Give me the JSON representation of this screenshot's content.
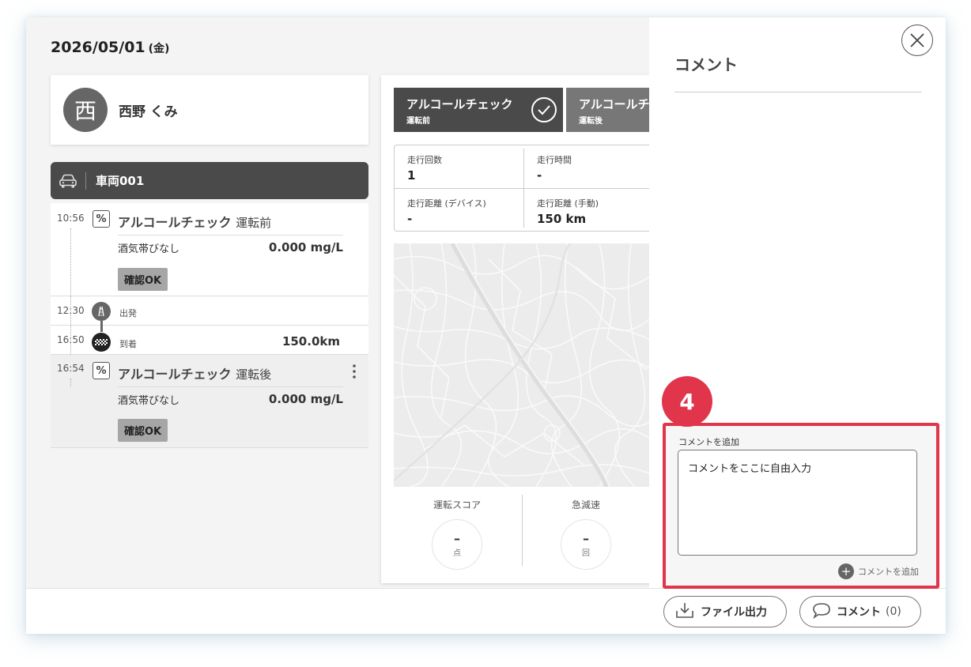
{
  "header": {
    "date": "2026/05/01",
    "weekday": "(金)"
  },
  "user": {
    "avatar_char": "西",
    "name": "西野 くみ"
  },
  "vehicle": {
    "name": "車両001"
  },
  "timeline": {
    "check_before": {
      "time": "10:56",
      "icon_glyph": "%",
      "title": "アルコールチェック",
      "subtitle": "運転前",
      "label": "酒気帯びなし",
      "value": "0.000 mg/L",
      "badge": "確認OK"
    },
    "depart": {
      "time": "12:30",
      "label": "出発"
    },
    "arrive": {
      "time": "16:50",
      "label": "到着",
      "value": "150.0km"
    },
    "check_after": {
      "time": "16:54",
      "icon_glyph": "%",
      "title": "アルコールチェック",
      "subtitle": "運転後",
      "label": "酒気帯びなし",
      "value": "0.000 mg/L",
      "badge": "確認OK"
    }
  },
  "tabs": [
    {
      "title": "アルコールチェック",
      "sub": "運転前"
    },
    {
      "title": "アルコールチェ",
      "sub": "運転後"
    }
  ],
  "stats": {
    "runs": {
      "label": "走行回数",
      "value": "1"
    },
    "duration": {
      "label": "走行時間",
      "value": "-"
    },
    "dist_device": {
      "label": "走行距離 (デバイス)",
      "value": "-"
    },
    "dist_manual": {
      "label": "走行距離 (手動)",
      "value": "150 km"
    }
  },
  "scores": [
    {
      "label": "運転スコア",
      "value": "–",
      "unit": "点"
    },
    {
      "label": "急減速",
      "value": "–",
      "unit": "回"
    }
  ],
  "bottom": {
    "export_label": "ファイル出力",
    "comment_label": "コメント",
    "comment_count": "(0)"
  },
  "comment_panel": {
    "title": "コメント",
    "step_number": "4",
    "field_label": "コメントを追加",
    "textarea_value": "コメントをここに自由入力",
    "add_label": "コメントを追加"
  },
  "colors": {
    "accent": "#e0354b",
    "dark_bar": "#4a4a4a"
  }
}
